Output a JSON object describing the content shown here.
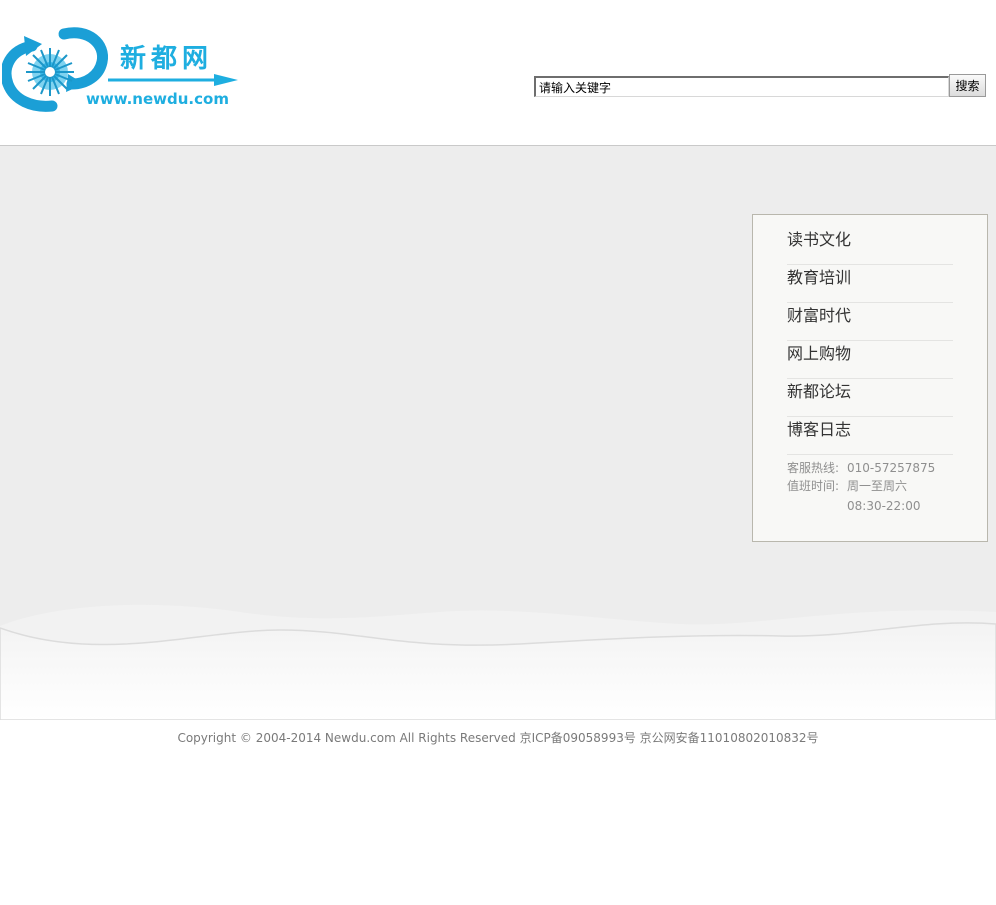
{
  "header": {
    "logo": {
      "name_cn": "新都网",
      "url_text": "www.newdu.com"
    },
    "search": {
      "value": "请输入关键字",
      "button_label": "搜索"
    }
  },
  "sidebar": {
    "items": [
      {
        "label": "读书文化"
      },
      {
        "label": "教育培训"
      },
      {
        "label": "财富时代"
      },
      {
        "label": "网上购物"
      },
      {
        "label": "新都论坛"
      },
      {
        "label": "博客日志"
      }
    ],
    "contact": {
      "hotline_label": "客服热线:",
      "hotline_value": "010-57257875",
      "hours_label": "值班时间:",
      "hours_days": "周一至周六",
      "hours_time": "08:30-22:00"
    }
  },
  "footer": {
    "copyright": "Copyright © 2004-2014 Newdu.com All Rights Reserved 京ICP备09058993号 京公网安备11010802010832号"
  },
  "colors": {
    "brand": "#1eaee0",
    "main_background": "#ededed",
    "panel_background": "#f8f8f6",
    "footer_text": "#7a7a7a"
  }
}
